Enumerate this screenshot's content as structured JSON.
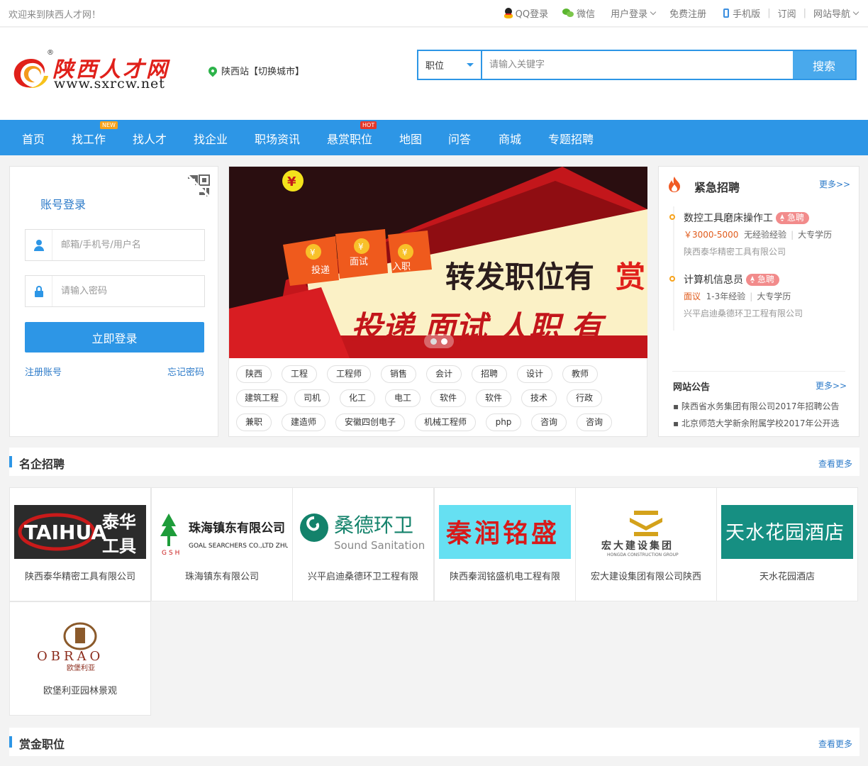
{
  "topbar": {
    "welcome": "欢迎来到陕西人才网！",
    "qq_login": "QQ登录",
    "wechat": "微信",
    "user_login": "用户登录",
    "register": "免费注册",
    "mobile": "手机版",
    "subscribe": "订阅",
    "site_nav": "网站导航"
  },
  "header": {
    "logo_title": "陕西人才网",
    "logo_url": "www.sxrcw.net",
    "logo_reg": "®",
    "city": "陕西站【切换城市】",
    "search": {
      "category": "职位",
      "placeholder": "请输入关键字",
      "button": "搜索"
    }
  },
  "nav": {
    "items": [
      {
        "label": "首页"
      },
      {
        "label": "找工作",
        "badge": "NEW"
      },
      {
        "label": "找人才"
      },
      {
        "label": "找企业"
      },
      {
        "label": "职场资讯"
      },
      {
        "label": "悬赏职位",
        "badge": "HOT"
      },
      {
        "label": "地图"
      },
      {
        "label": "问答"
      },
      {
        "label": "商城"
      },
      {
        "label": "专题招聘"
      }
    ]
  },
  "login": {
    "title": "账号登录",
    "username_placeholder": "邮箱/手机号/用户名",
    "password_placeholder": "请输入密码",
    "submit": "立即登录",
    "register_link": "注册账号",
    "forgot_link": "忘记密码"
  },
  "banner": {
    "headline_a": "转发职位有",
    "headline_b": "赏",
    "steps_line": "投递   面试   人职   有",
    "envelope_labels": [
      "投递",
      "面试",
      "入职"
    ],
    "coin_symbol": "¥"
  },
  "tags": [
    "陕西",
    "工程",
    "工程师",
    "销售",
    "会计",
    "招聘",
    "设计",
    "教师",
    "建筑工程",
    "司机",
    "化工",
    "电工",
    "软件",
    "软件",
    "技术",
    "行政",
    "兼职",
    "建造师",
    "安徽四创电子",
    "机械工程师",
    "php",
    "咨询",
    "咨询"
  ],
  "urgent": {
    "title": "紧急招聘",
    "more": "更多>>",
    "jobs": [
      {
        "title": "数控工具磨床操作工",
        "badge": "急聘",
        "salary": "￥3000-5000",
        "experience": "无经验经验",
        "education": "大专学历",
        "company": "陕西泰华精密工具有限公司"
      },
      {
        "title": "计算机信息员",
        "badge": "急聘",
        "salary": "面议",
        "experience": "1-3年经验",
        "education": "大专学历",
        "company": "兴平启迪桑德环卫工程有限公司"
      }
    ],
    "notice_title": "网站公告",
    "notice_more": "更多>>",
    "notices": [
      "陕西省水务集团有限公司2017年招聘公告",
      "北京师范大学新余附属学校2017年公开选"
    ]
  },
  "famous": {
    "title": "名企招聘",
    "more": "查看更多",
    "companies": [
      {
        "name": "陕西泰华精密工具有限公司",
        "logo_text": "TAIHUA",
        "logo_cn": "泰华工具"
      },
      {
        "name": "珠海镇东有限公司",
        "logo_text": "GSH",
        "logo_cn": "珠海镇东有限公司",
        "logo_en": "GOAL SEARCHERS CO.,LTD ZHUHAI"
      },
      {
        "name": "兴平启迪桑德环卫工程有限",
        "logo_cn": "桑德环卫",
        "logo_en": "Sound Sanitation"
      },
      {
        "name": "陕西秦润铭盛机电工程有限",
        "logo_cn": "秦润铭盛"
      },
      {
        "name": "宏大建设集团有限公司陕西",
        "logo_cn": "宏大建设集团",
        "logo_en": "HONGDA CONSTRUCTION GROUP"
      },
      {
        "name": "天水花园酒店",
        "logo_cn": "天水花园酒店"
      },
      {
        "name": "欧堡利亚园林景观",
        "logo_text": "OBRAO",
        "logo_cn": "欧堡利亚"
      }
    ]
  },
  "bounty": {
    "title": "赏金职位",
    "more": "查看更多"
  },
  "colors": {
    "primary": "#2d96e6",
    "link": "#2d7bc9",
    "urgent": "#f28b8b",
    "salary": "#e05a1a",
    "logo_red": "#e0201a"
  }
}
